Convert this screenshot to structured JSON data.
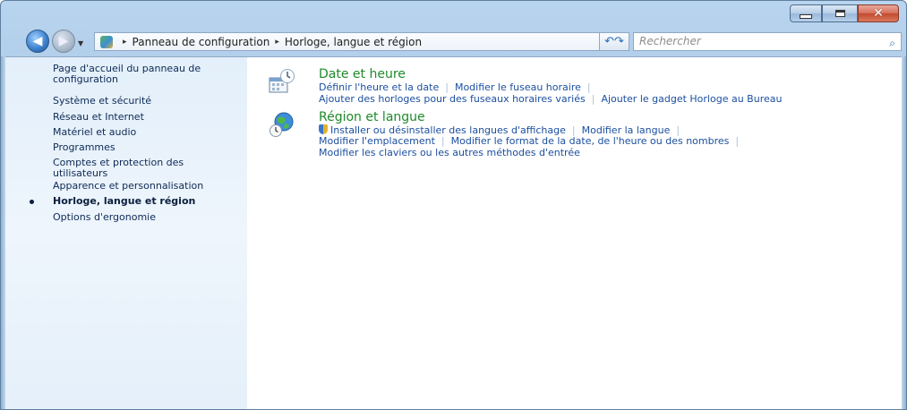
{
  "window": {
    "caption": {
      "minimize": "—",
      "maximize": "□",
      "close": "✕"
    }
  },
  "nav": {
    "back_symbol": "◀",
    "forward_symbol": "▶",
    "breadcrumb": [
      "Panneau de configuration",
      "Horloge, langue et région"
    ],
    "crumb_separator": "▸",
    "refresh_symbol": "↶↷",
    "search_placeholder": "Rechercher"
  },
  "sidebar": {
    "items": [
      {
        "label": "Page d'accueil du panneau de configuration",
        "active": false
      },
      {
        "label": "Système et sécurité",
        "active": false
      },
      {
        "label": "Réseau et Internet",
        "active": false
      },
      {
        "label": "Matériel et audio",
        "active": false
      },
      {
        "label": "Programmes",
        "active": false
      },
      {
        "label": "Comptes et protection des utilisateurs",
        "active": false
      },
      {
        "label": "Apparence et personnalisation",
        "active": false
      },
      {
        "label": "Horloge, langue et région",
        "active": true
      },
      {
        "label": "Options d'ergonomie",
        "active": false
      }
    ]
  },
  "categories": [
    {
      "title": "Date et heure",
      "icon": "date-time-icon",
      "links": [
        [
          "Définir l'heure et la date",
          "Modifier le fuseau horaire"
        ],
        [
          "Ajouter des horloges pour des fuseaux horaires variés",
          "Ajouter le gadget Horloge au Bureau"
        ]
      ]
    },
    {
      "title": "Région et langue",
      "icon": "region-globe-icon",
      "links": [
        [
          "Installer ou désinstaller des langues d'affichage",
          "Modifier la langue"
        ],
        [
          "Modifier l'emplacement",
          "Modifier le format de la date, de l'heure ou des nombres"
        ],
        [
          "Modifier les claviers ou les autres méthodes d'entrée"
        ]
      ]
    }
  ],
  "colors": {
    "category_title": "#1e8a2a",
    "link": "#1b4fa0",
    "sidebar_text": "#0d2a55"
  }
}
